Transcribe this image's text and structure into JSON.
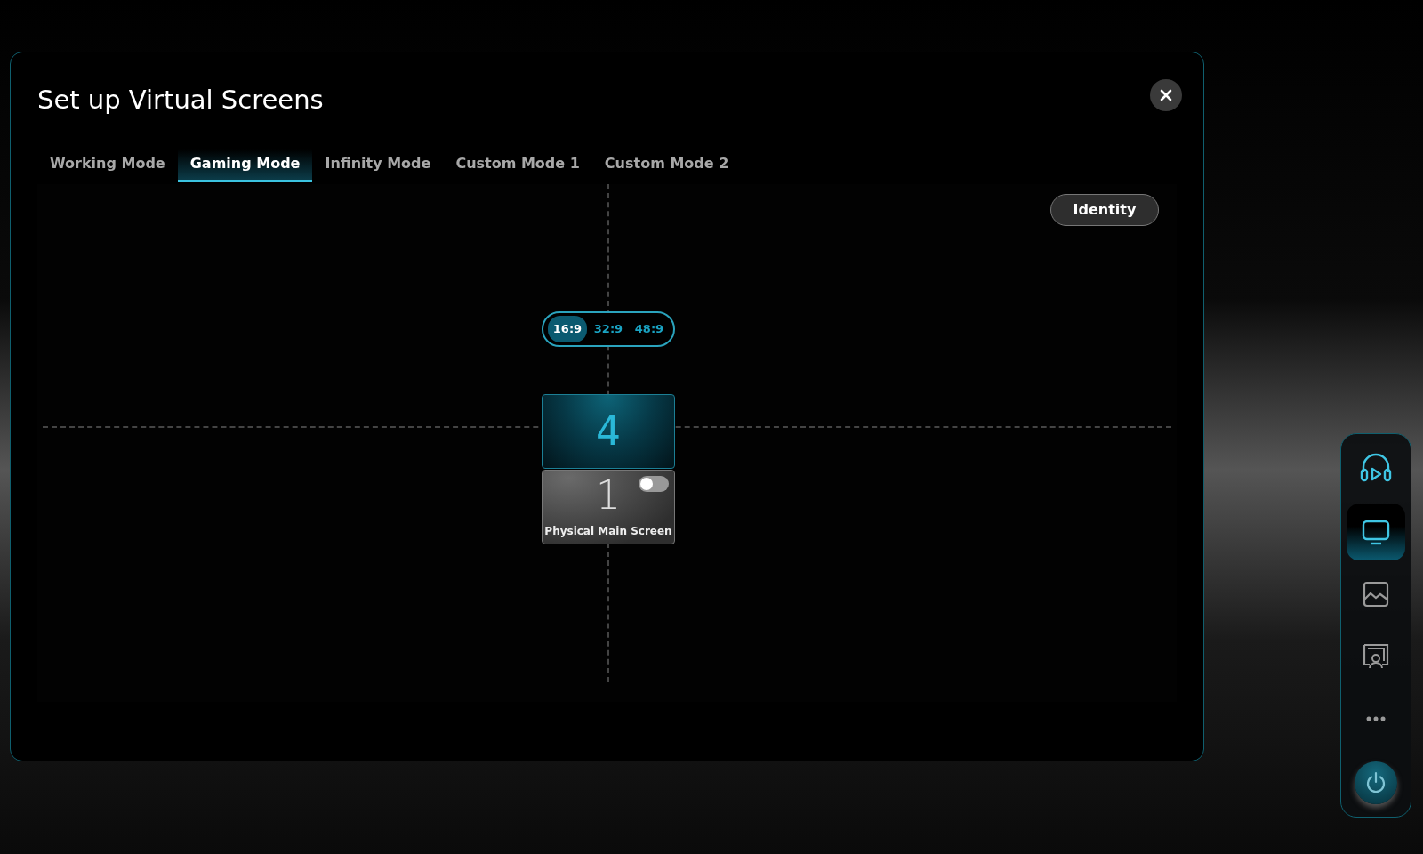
{
  "window": {
    "title": "Set up Virtual Screens"
  },
  "tabs": [
    {
      "label": "Working Mode",
      "selected": false
    },
    {
      "label": "Gaming Mode",
      "selected": true
    },
    {
      "label": "Infinity Mode",
      "selected": false
    },
    {
      "label": "Custom Mode 1",
      "selected": false
    },
    {
      "label": "Custom Mode 2",
      "selected": false
    }
  ],
  "identity_button": "Identity",
  "ratios": [
    {
      "label": "16:9",
      "selected": true
    },
    {
      "label": "32:9",
      "selected": false
    },
    {
      "label": "48:9",
      "selected": false
    }
  ],
  "screens": [
    {
      "number": "4",
      "kind": "virtual"
    },
    {
      "number": "1",
      "kind": "physical",
      "caption": "Physical Main Screen",
      "on": false
    }
  ],
  "sidebar": {
    "items": [
      {
        "selected": false
      },
      {
        "selected": true
      },
      {
        "selected": false
      },
      {
        "selected": false
      },
      {
        "selected": false
      }
    ]
  }
}
